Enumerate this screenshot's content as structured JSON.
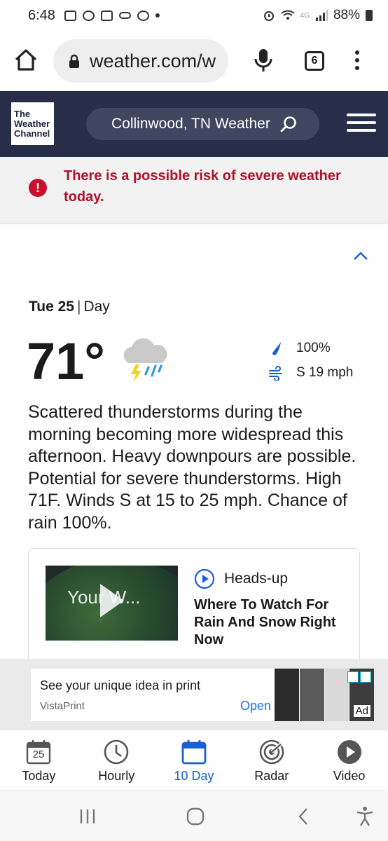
{
  "status_bar": {
    "time": "6:48",
    "network": "4G",
    "battery": "88%"
  },
  "browser": {
    "url": "weather.com/w",
    "tab_count": "6"
  },
  "header": {
    "logo_lines": [
      "The",
      "Weather",
      "Channel"
    ],
    "location_search": "Collinwood, TN Weather"
  },
  "alert": {
    "text": "There is a possible risk of severe weather today."
  },
  "forecast": {
    "day": "Tue 25",
    "period": "Day",
    "temperature": "71°",
    "precip_chance": "100%",
    "wind": "S 19 mph",
    "description": "Scattered thunderstorms during the morning becoming more widespread this afternoon. Heavy downpours are possible. Potential for severe thunderstorms. High 71F. Winds S at 15 to 25 mph. Chance of rain 100%."
  },
  "video": {
    "thumbnail_title": "Your W...",
    "tag": "Heads-up",
    "headline": "Where To Watch For Rain And Snow Right Now"
  },
  "ad": {
    "title": "See your unique idea in print",
    "brand": "VistaPrint",
    "cta": "Open",
    "label": "Ad"
  },
  "bottom_nav": {
    "items": [
      {
        "label": "Today",
        "icon": "calendar-day-icon",
        "date": "25"
      },
      {
        "label": "Hourly",
        "icon": "clock-icon"
      },
      {
        "label": "10 Day",
        "icon": "calendar-icon"
      },
      {
        "label": "Radar",
        "icon": "radar-icon"
      },
      {
        "label": "Video",
        "icon": "play-circle-icon"
      }
    ],
    "active_index": 2
  },
  "colors": {
    "header_bg": "#282d4a",
    "alert_red": "#b01228",
    "active_blue": "#1a5fcf"
  }
}
